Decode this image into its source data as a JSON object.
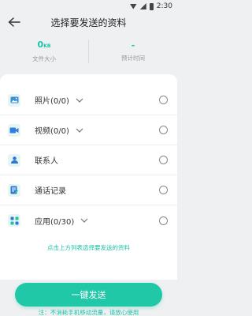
{
  "status_bar": {
    "time": "2:30"
  },
  "header": {
    "title": "选择要发送的资料"
  },
  "stats": [
    {
      "value": "0",
      "unit": "KB",
      "label": "文件大小"
    },
    {
      "value": "-",
      "unit": "",
      "label": "预计时间"
    }
  ],
  "items": [
    {
      "label": "照片(0/0)",
      "icon": "image-icon",
      "has_chevron": true
    },
    {
      "label": "视频(0/0)",
      "icon": "video-icon",
      "has_chevron": true
    },
    {
      "label": "联系人",
      "icon": "contact-icon",
      "has_chevron": false
    },
    {
      "label": "通话记录",
      "icon": "call-log-icon",
      "has_chevron": false
    },
    {
      "label": "应用(0/30)",
      "icon": "apps-icon",
      "has_chevron": true
    }
  ],
  "hint": "点击上方列表选择要发送的资料",
  "send_button": "一键发送",
  "note": "注：不消耗手机移动流量，请放心使用",
  "colors": {
    "accent": "#21c8a8",
    "background": "#eef0f2"
  }
}
